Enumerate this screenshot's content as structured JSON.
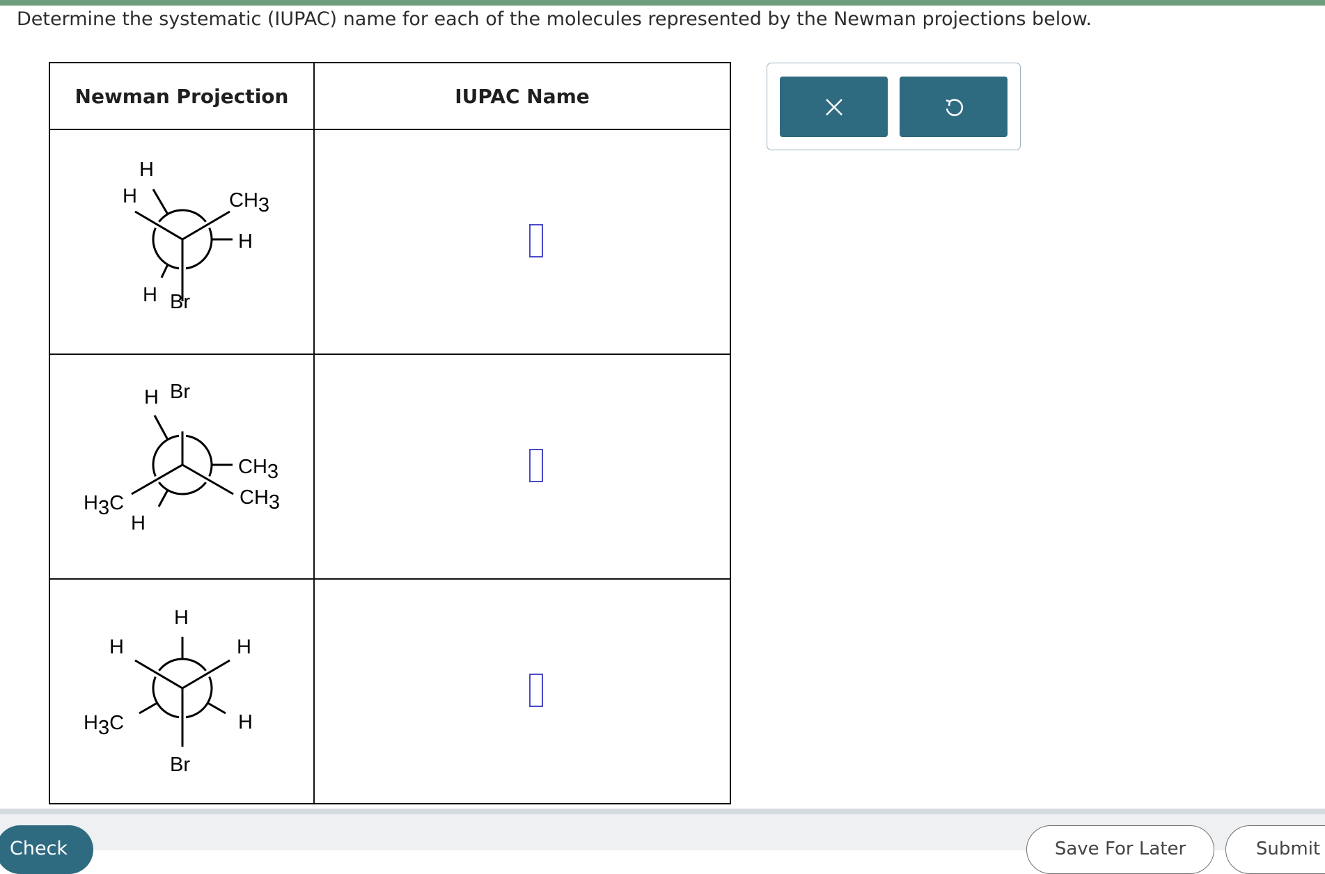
{
  "question": "Determine the systematic (IUPAC) name for each of the molecules represented by the Newman projections below.",
  "table": {
    "header_projection": "Newman Projection",
    "header_name": "IUPAC Name",
    "rows": [
      {
        "front": {
          "up_left": "H",
          "up_right": "CH3",
          "down": "Br"
        },
        "back": {
          "up": "H",
          "right": "H",
          "down_left": "H"
        },
        "answer": ""
      },
      {
        "front": {
          "up": "Br",
          "right_down": "CH3",
          "left_down": "H3C"
        },
        "back": {
          "up_left": "H",
          "right": "CH3",
          "down_left": "H"
        },
        "answer": ""
      },
      {
        "front": {
          "up_left": "H",
          "up_right": "H",
          "down": "Br"
        },
        "back": {
          "up": "H",
          "down_left": "H3C",
          "down_right": "H"
        },
        "answer": ""
      }
    ]
  },
  "toolbar": {
    "clear_icon": "close-icon",
    "undo_icon": "undo-icon"
  },
  "footer": {
    "check_label": "Check",
    "save_label": "Save For Later",
    "submit_label": "Submit"
  },
  "colors": {
    "accent": "#2f6b80",
    "top_bar": "#6e9e7e",
    "answer_box_border": "#4a4acc"
  }
}
